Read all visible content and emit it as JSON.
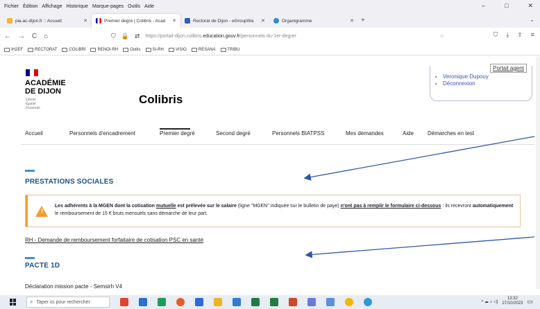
{
  "menubar": {
    "items": [
      "Fichier",
      "Édition",
      "Affichage",
      "Historique",
      "Marque-pages",
      "Outils",
      "Aide"
    ]
  },
  "window_controls": {
    "minimize": "–",
    "maximize": "□",
    "close": "✕"
  },
  "tabs": [
    {
      "label": "pia.ac-dijon.fr :: Accueil",
      "favicon_color": "#f2b632",
      "active": false
    },
    {
      "label": "Premier degré | Colibris - Acad",
      "favicon_color": "#e1000f",
      "active": true
    },
    {
      "label": "Rectorat de Dijon - eGroupWa",
      "favicon_color": "#2b5fb8",
      "active": false
    },
    {
      "label": "Organigramme",
      "favicon_color": "#2a8dd4",
      "active": false
    }
  ],
  "tab_close": "✕",
  "new_tab": "+",
  "tab_list": "⌄",
  "nav": {
    "back": "←",
    "forward": "→",
    "reload": "C",
    "home": "⌂"
  },
  "url": {
    "scheme": "https://portail-dijon.colibris.",
    "host": "education.gouv.fr",
    "path": "/personnels-du-1er-degre/"
  },
  "url_icons": {
    "shield": "⛉",
    "lock": "🔒",
    "perm": "⇄",
    "star": "☆"
  },
  "toolbar_right": {
    "pocket": "⛉",
    "download": "⤓",
    "share": "⇪",
    "menu": "≡"
  },
  "bookmarks": [
    "IH2EF",
    "RECTORAT",
    "COLIBRI",
    "RENOI-RH",
    "Outils",
    "SI-RH",
    "VISIO",
    "RESANA",
    "TRIBU"
  ],
  "page": {
    "flag_colors": [
      "#000091",
      "#ffffff",
      "#e1000f"
    ],
    "academy_line1": "ACADÉMIE",
    "academy_line2": "DE DIJON",
    "motto": [
      "Liberté",
      "Égalité",
      "Fraternité"
    ],
    "site_name": "Colibris",
    "user_menu": [
      "Veronique Dupouy",
      "Déconnexion"
    ],
    "portail_agent": "Portail agent",
    "main_nav": [
      "Accueil",
      "Personnels d'encadrement",
      "Premier degré",
      "Second degré",
      "Personnels BIATPSS",
      "Mes demandes",
      "Aide",
      "Démarches en test"
    ],
    "active_nav": "Premier degré",
    "section1_title": "PRESTATIONS SOCIALES",
    "alert": {
      "part1": "Les adhérents à la MGEN dont la cotisation ",
      "part2": "mutuelle",
      "part3": " est prélevée sur le salaire",
      "part4": " (ligne \"MGEN\" indiquée sur le bulletin de paye) ",
      "part5": "n'ont pas à remplir le formulaire ci-dessous",
      "part6": " : ils recevront ",
      "part7": "automatiquement",
      "part8": " le remboursement de 15 € bruts mensuels sans démarche de leur part."
    },
    "link1": "RH - Demande de remboursement forfaitaire de cotisation PSC en santé",
    "section2_title": "PACTE 1D",
    "link2": "Déclaration mission pacte - Semsirh V4"
  },
  "taskbar": {
    "search_placeholder": "Taper ici pour rechercher",
    "icon_colors": [
      "#e0452b",
      "#2b6fd0",
      "#1e9c5a",
      "#e85d1e",
      "#2a6ad9",
      "#f0b429",
      "#2f7bd6",
      "#1e7d45",
      "#1e7d45",
      "#d24726",
      "#6a7bd6",
      "#5a8fe0",
      "#f4b400",
      "#2a9bd6"
    ],
    "time": "13:32",
    "date": "27/10/2023",
    "tray": "^ ☁ ⌂ ◁) "
  },
  "accent_colors": {
    "arrow": "#2e57a8",
    "section_title": "#1a4f8a",
    "section_bar": "#3a8fd6",
    "alert_stripe": "#f39c2b",
    "user_link": "#3a4fc0"
  }
}
